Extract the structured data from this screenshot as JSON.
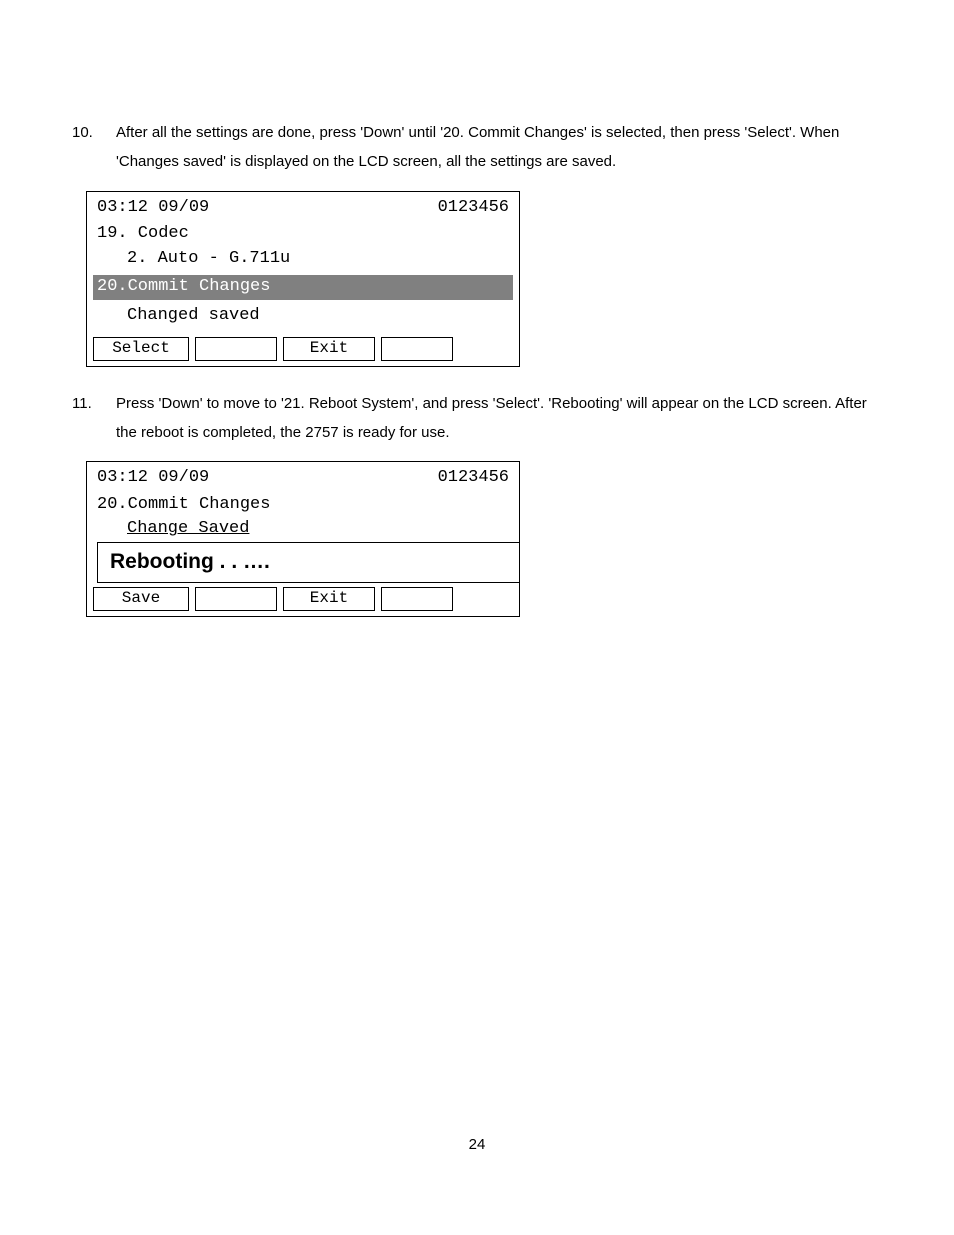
{
  "steps": [
    {
      "num": "10.",
      "text": "After all the settings are done, press 'Down' until '20. Commit Changes' is selected, then press 'Select'. When 'Changes saved' is displayed on the LCD screen, all the settings are saved."
    },
    {
      "num": "11.",
      "text": "Press 'Down' to move to '21. Reboot System', and press 'Select'.   'Rebooting' will appear on the LCD screen.   After the reboot is completed, the 2757 is ready for use."
    }
  ],
  "lcd1": {
    "time": "03:12 09/09",
    "code": "0123456",
    "line1": "19. Codec",
    "line2": "2. Auto - G.711u",
    "highlight": "20.Commit Changes",
    "status": "Changed saved",
    "btn1": "Select",
    "btn2": "Exit"
  },
  "lcd2": {
    "time": "03:12 09/09",
    "code": "0123456",
    "line1": "20.Commit Changes",
    "line2": "Change Saved",
    "reboot": "Rebooting . . ….",
    "btn1": "Save",
    "btn2": "Exit"
  },
  "page_number": "24"
}
